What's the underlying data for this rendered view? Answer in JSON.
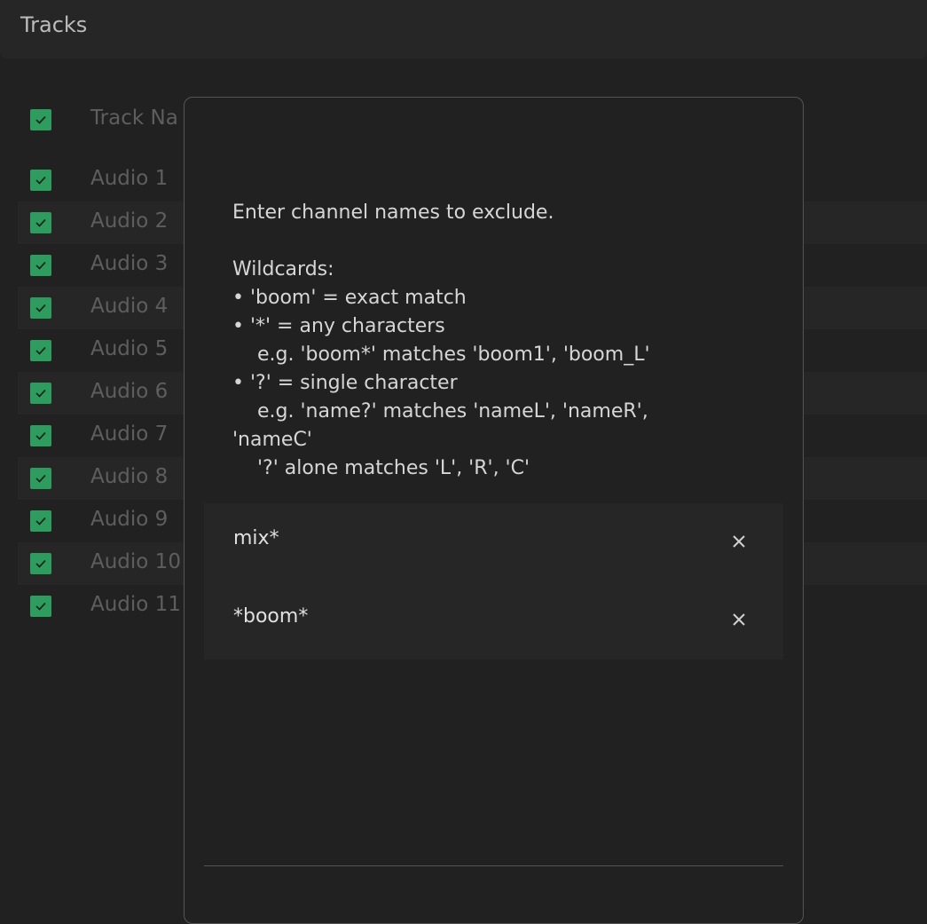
{
  "header": {
    "title": "Tracks"
  },
  "table": {
    "header_label": "Track Na",
    "rows": [
      {
        "label": "Audio 1"
      },
      {
        "label": "Audio 2"
      },
      {
        "label": "Audio 3"
      },
      {
        "label": "Audio 4"
      },
      {
        "label": "Audio 5"
      },
      {
        "label": "Audio 6"
      },
      {
        "label": "Audio 7"
      },
      {
        "label": "Audio 8"
      },
      {
        "label": "Audio 9"
      },
      {
        "label": "Audio 10"
      },
      {
        "label": "Audio 11"
      }
    ]
  },
  "modal": {
    "instructions": "Enter channel names to exclude.\n\nWildcards:\n• 'boom' = exact match\n• '*' = any characters\n    e.g. 'boom*' matches 'boom1', 'boom_L'\n• '?' = single character\n    e.g. 'name?' matches 'nameL', 'nameR',\n'nameC'\n    '?' alone matches 'L', 'R', 'C'",
    "exclusions": [
      {
        "value": "mix*"
      },
      {
        "value": "*boom*"
      }
    ]
  },
  "colors": {
    "checkbox": "#2f9c5f",
    "background": "#212121",
    "panel": "#262626"
  }
}
